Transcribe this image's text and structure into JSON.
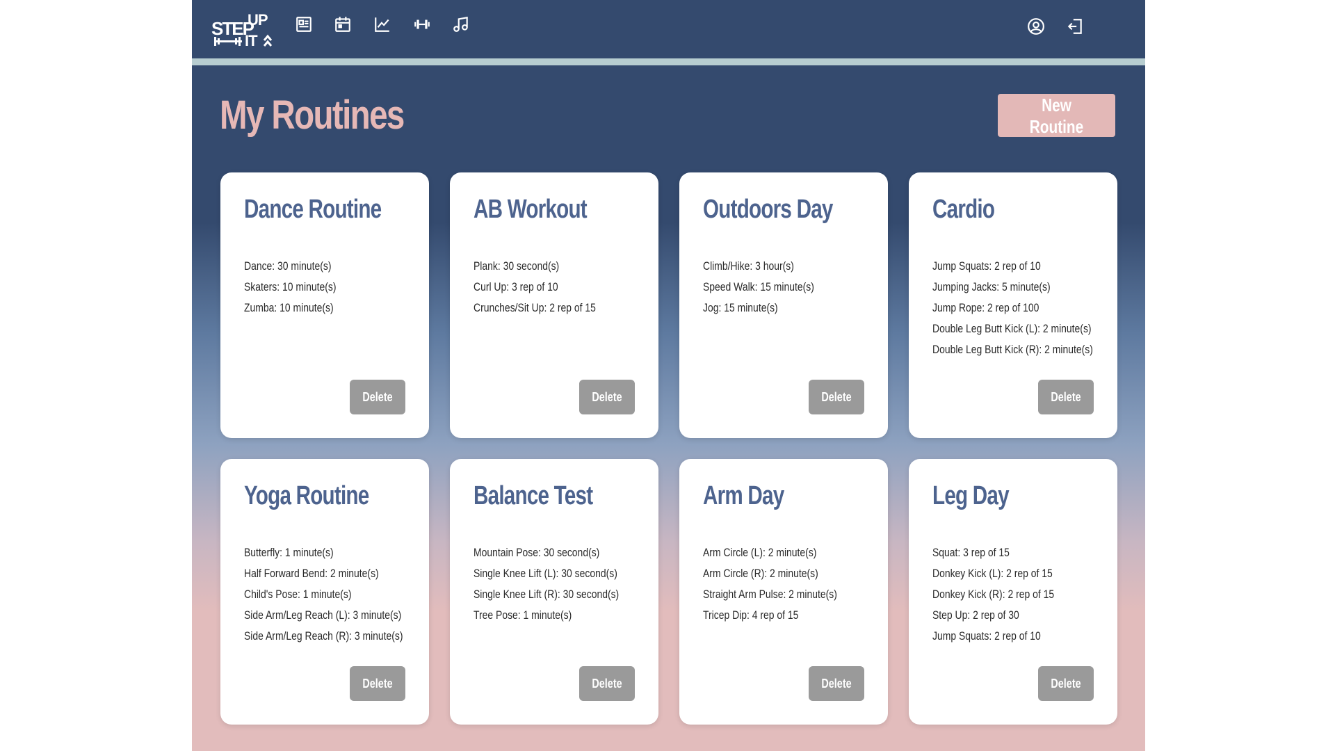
{
  "header": {
    "logo_text_top": "STEP UP",
    "logo_text_bottom": "IT",
    "nav_icons": [
      "newspaper-icon",
      "calendar-icon",
      "chart-line-icon",
      "dumbbell-icon",
      "music-note-icon"
    ],
    "right_icons": [
      "user-circle-icon",
      "logout-icon"
    ]
  },
  "page": {
    "title": "My Routines",
    "new_routine_label": "New Routine"
  },
  "routines": [
    {
      "title": "Dance Routine",
      "exercises": [
        "Dance: 30 minute(s)",
        "Skaters: 10 minute(s)",
        "Zumba: 10 minute(s)"
      ],
      "delete_label": "Delete"
    },
    {
      "title": "AB Workout",
      "exercises": [
        "Plank: 30 second(s)",
        "Curl Up: 3 rep of 10",
        "Crunches/Sit Up: 2 rep of 15"
      ],
      "delete_label": "Delete"
    },
    {
      "title": "Outdoors Day",
      "exercises": [
        "Climb/Hike: 3 hour(s)",
        "Speed Walk: 15 minute(s)",
        "Jog: 15 minute(s)"
      ],
      "delete_label": "Delete"
    },
    {
      "title": "Cardio",
      "exercises": [
        "Jump Squats: 2 rep of 10",
        "Jumping Jacks: 5 minute(s)",
        "Jump Rope: 2 rep of 100",
        "Double Leg Butt Kick (L): 2 minute(s)",
        "Double Leg Butt Kick (R): 2 minute(s)"
      ],
      "delete_label": "Delete"
    },
    {
      "title": "Yoga Routine",
      "exercises": [
        "Butterfly: 1 minute(s)",
        "Half Forward Bend: 2 minute(s)",
        "Child's Pose: 1 minute(s)",
        "Side Arm/Leg Reach (L): 3 minute(s)",
        "Side Arm/Leg Reach (R): 3 minute(s)"
      ],
      "delete_label": "Delete"
    },
    {
      "title": "Balance Test",
      "exercises": [
        "Mountain Pose: 30 second(s)",
        "Single Knee Lift (L): 30 second(s)",
        "Single Knee Lift (R): 30 second(s)",
        "Tree Pose: 1 minute(s)"
      ],
      "delete_label": "Delete"
    },
    {
      "title": "Arm Day",
      "exercises": [
        "Arm Circle (L): 2 minute(s)",
        "Arm Circle (R): 2 minute(s)",
        "Straight Arm Pulse: 2 minute(s)",
        "Tricep Dip: 4 rep of 15"
      ],
      "delete_label": "Delete"
    },
    {
      "title": "Leg Day",
      "exercises": [
        "Squat: 3 rep of 15",
        "Donkey Kick (L): 2 rep of 15",
        "Donkey Kick (R): 2 rep of 15",
        "Step Up: 2 rep of 30",
        "Jump Squats: 2 rep of 10"
      ],
      "delete_label": "Delete"
    }
  ],
  "colors": {
    "navy": "#344a6e",
    "pink": "#e3b8b7",
    "card_title": "#4d638e",
    "delete_gray": "#9a9a9a"
  }
}
